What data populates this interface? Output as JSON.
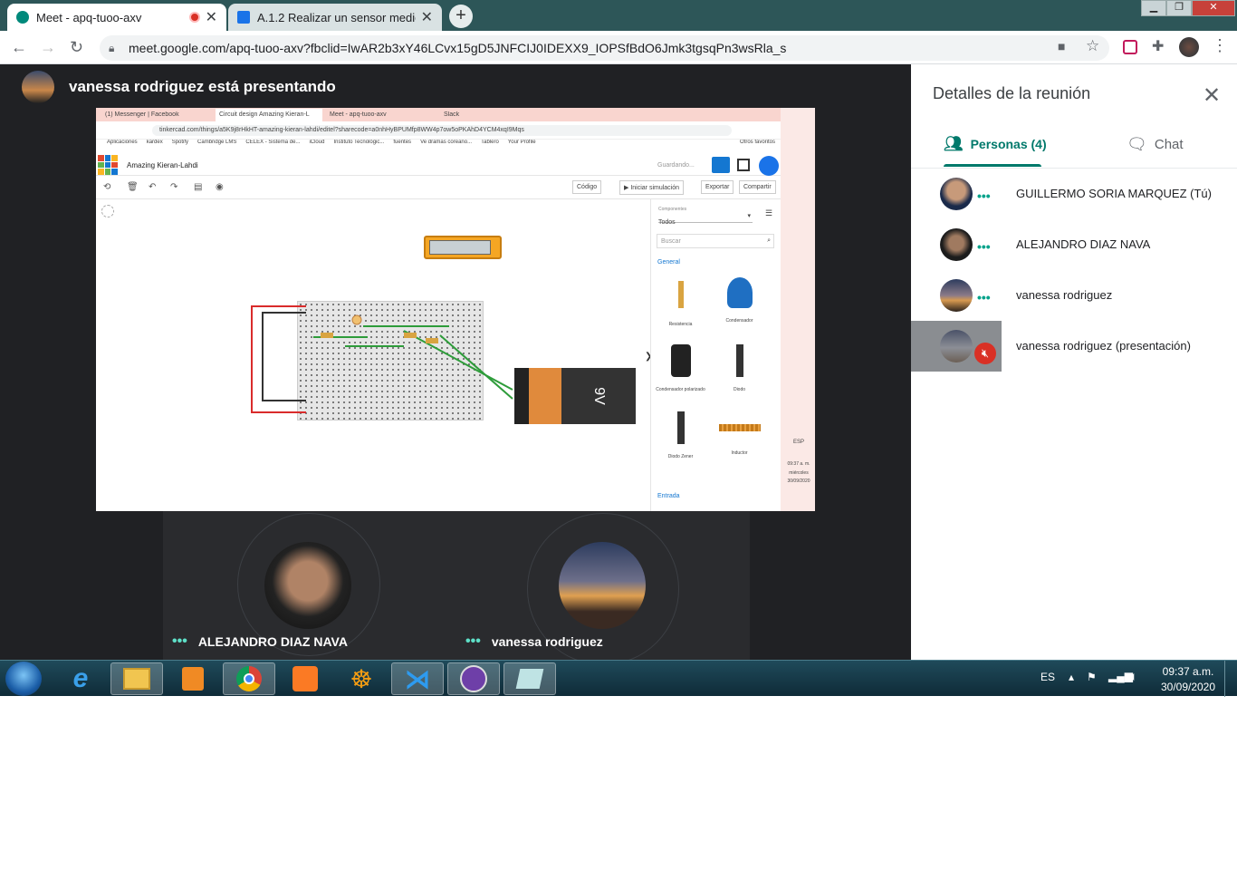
{
  "browser": {
    "tabs": [
      {
        "title": "Meet - apq-tuoo-axv"
      },
      {
        "title": "A.1.2 Realizar un sensor medic"
      }
    ],
    "url": "meet.google.com/apq-tuoo-axv?fbclid=IwAR2b3xY46LCvx15gD5JNFCIJ0IDEXX9_IOPSfBdO6Jmk3tgsqPn3wsRla_s"
  },
  "meet": {
    "presenting": "vanessa rodriguez está presentando",
    "tiles": [
      {
        "name": "ALEJANDRO DIAZ NAVA"
      },
      {
        "name": "vanessa rodriguez"
      }
    ]
  },
  "panel": {
    "title": "Detalles de la reunión",
    "tab_people": "Personas (4)",
    "tab_chat": "Chat",
    "people": [
      {
        "name": "GUILLERMO SORIA MARQUEZ (Tú)"
      },
      {
        "name": "ALEJANDRO DIAZ NAVA"
      },
      {
        "name": "vanessa rodriguez"
      },
      {
        "name": "vanessa rodriguez (presentación)"
      }
    ]
  },
  "shared_screen": {
    "tabs": [
      "(1) Messenger | Facebook",
      "Circuit design Amazing Kieran-L",
      "Meet - apq-tuoo-axv",
      "Slack"
    ],
    "url": "tinkercad.com/things/a5K9j8rHkHT-amazing-kieran-lahdi/editel?sharecode=a0nhHyBPUMfp8WW4p7ow5oPKAhD4YCM4xqI9Mqs",
    "bookmarks": [
      "Aplicaciones",
      "kardex",
      "Spotify",
      "Cambridge LMS",
      "CELEX - Sistema de...",
      "iCloud",
      "Instituto Tecnológic...",
      "fuentes",
      "Ve dramas coreano...",
      "Tablero",
      "Your Profile",
      "Otros favoritos"
    ],
    "project": "Amazing Kieran-Lahdi",
    "saving": "Guardando...",
    "buttons": {
      "code": "Código",
      "simulate": "Iniciar simulación",
      "export": "Exportar",
      "share": "Compartir"
    },
    "components_label": "Componentes",
    "components_value": "Todos",
    "search_placeholder": "Buscar",
    "section_general": "General",
    "section_input": "Entrada",
    "parts": [
      "Resistencia",
      "Condensador",
      "Condensador polarizado",
      "Diodo",
      "Diodo Zener",
      "Inductor"
    ],
    "battery_label": "9V",
    "tray": {
      "lang": "ESP",
      "time": "09:37 a. m.",
      "day": "miércoles",
      "date": "30/09/2020"
    }
  },
  "taskbar": {
    "lang": "ES",
    "time": "09:37 a.m.",
    "date": "30/09/2020"
  },
  "colors": {
    "accent": "#00796b",
    "stage": "#202124",
    "tabstrip": "#2d5658"
  }
}
